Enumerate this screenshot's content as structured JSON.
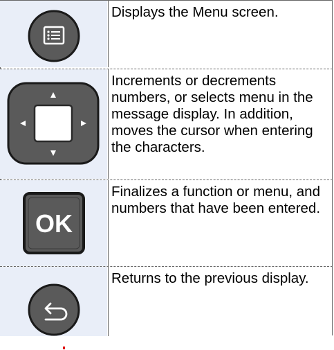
{
  "rows": [
    {
      "icon": "menu-button-icon",
      "description": "Displays the Menu screen."
    },
    {
      "icon": "arrow-keys-icon",
      "description": "Increments or decrements numbers, or selects menu in the message display. In addition, moves the cursor when entering the characters."
    },
    {
      "icon": "ok-button-icon",
      "label": "OK",
      "description": "Finalizes a function or menu, and numbers that have been entered."
    },
    {
      "icon": "back-button-icon",
      "description": "Returns to the previous display."
    }
  ],
  "colors": {
    "cell_bg": "#e9eef8",
    "key_fill": "#5a5a5a",
    "key_border": "#1a1a1a",
    "key_glyph": "#ffffff"
  }
}
